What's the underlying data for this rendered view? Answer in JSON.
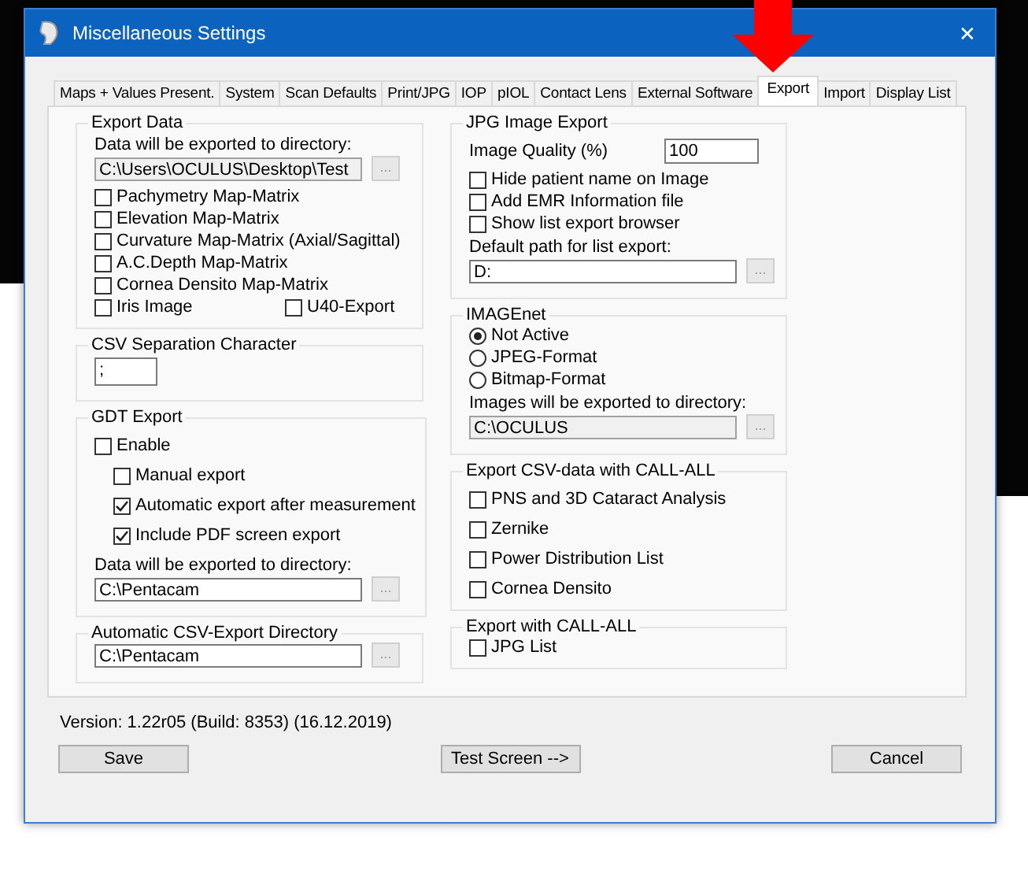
{
  "window": {
    "title": "Miscellaneous Settings",
    "close": "✕"
  },
  "tabs": [
    {
      "label": "Maps + Values Present.",
      "selected": false
    },
    {
      "label": "System",
      "selected": false
    },
    {
      "label": "Scan Defaults",
      "selected": false
    },
    {
      "label": "Print/JPG",
      "selected": false
    },
    {
      "label": "IOP",
      "selected": false
    },
    {
      "label": "pIOL",
      "selected": false
    },
    {
      "label": "Contact Lens",
      "selected": false
    },
    {
      "label": "External Software",
      "selected": false
    },
    {
      "label": "Export",
      "selected": true
    },
    {
      "label": "Import",
      "selected": false
    },
    {
      "label": "Display List",
      "selected": false
    }
  ],
  "columns": [
    {
      "groups": [
        {
          "title": "Export Data",
          "items": [
            {
              "kind": "label",
              "text": "Data will be exported to directory:"
            },
            {
              "kind": "path",
              "value": "C:\\Users\\OCULUS\\Desktop\\Test",
              "disabled": true,
              "browse": "..."
            },
            {
              "kind": "checkbox",
              "label": "Pachymetry Map-Matrix",
              "checked": false
            },
            {
              "kind": "checkbox",
              "label": "Elevation Map-Matrix",
              "checked": false
            },
            {
              "kind": "checkbox",
              "label": "Curvature Map-Matrix (Axial/Sagittal)",
              "checked": false
            },
            {
              "kind": "checkbox",
              "label": "A.C.Depth Map-Matrix",
              "checked": false
            },
            {
              "kind": "checkbox",
              "label": "Cornea Densito Map-Matrix",
              "checked": false
            },
            {
              "kind": "checkbox_row",
              "items": [
                {
                  "label": "Iris Image",
                  "checked": false
                },
                {
                  "label": "U40-Export",
                  "checked": false
                }
              ]
            }
          ]
        },
        {
          "title": "CSV Separation Character",
          "items": [
            {
              "kind": "field",
              "value": ";"
            }
          ]
        },
        {
          "title": "GDT Export",
          "items": [
            {
              "kind": "checkbox",
              "label": "Enable",
              "checked": false,
              "children": [
                {
                  "label": "Manual export",
                  "checked": false
                },
                {
                  "label": "Automatic export after measurement",
                  "checked": true
                },
                {
                  "label": "Include PDF screen export",
                  "checked": true
                }
              ]
            },
            {
              "kind": "label",
              "text": "Data will be exported to directory:"
            },
            {
              "kind": "path",
              "value": "C:\\Pentacam",
              "disabled": false,
              "browse": "..."
            }
          ]
        },
        {
          "title": "Automatic CSV-Export Directory",
          "items": [
            {
              "kind": "path",
              "value": "C:\\Pentacam",
              "disabled": false,
              "browse": "..."
            }
          ]
        }
      ]
    },
    {
      "groups": [
        {
          "title": "JPG Image Export",
          "items": [
            {
              "kind": "labeled_field",
              "label": "Image Quality (%)",
              "value": "100"
            },
            {
              "kind": "checkbox",
              "label": "Hide patient name on Image",
              "checked": false
            },
            {
              "kind": "checkbox",
              "label": "Add EMR Information file",
              "checked": false
            },
            {
              "kind": "checkbox",
              "label": "Show list export browser",
              "checked": false
            },
            {
              "kind": "label",
              "text": "Default path for list export:"
            },
            {
              "kind": "path",
              "value": "D:",
              "disabled": false,
              "browse": "..."
            }
          ]
        },
        {
          "title": "IMAGEnet",
          "items": [
            {
              "kind": "radio",
              "label": "Not Active",
              "selected": true
            },
            {
              "kind": "radio",
              "label": "JPEG-Format",
              "selected": false
            },
            {
              "kind": "radio",
              "label": "Bitmap-Format",
              "selected": false
            },
            {
              "kind": "label",
              "text": "Images will be exported to directory:"
            },
            {
              "kind": "path",
              "value": "C:\\OCULUS",
              "disabled": true,
              "browse": "..."
            }
          ]
        },
        {
          "title": "Export CSV-data with CALL-ALL",
          "items": [
            {
              "kind": "checkbox",
              "label": "PNS and 3D Cataract Analysis",
              "checked": false
            },
            {
              "kind": "checkbox",
              "label": "Zernike",
              "checked": false
            },
            {
              "kind": "checkbox",
              "label": "Power Distribution List",
              "checked": false
            },
            {
              "kind": "checkbox",
              "label": "Cornea Densito",
              "checked": false
            }
          ]
        },
        {
          "title": "Export with CALL-ALL",
          "items": [
            {
              "kind": "checkbox",
              "label": "JPG List",
              "checked": false
            }
          ]
        }
      ]
    }
  ],
  "version": "Version: 1.22r05  (Build: 8353) (16.12.2019)",
  "buttons": [
    "Save",
    "Test Screen -->",
    "Cancel"
  ]
}
